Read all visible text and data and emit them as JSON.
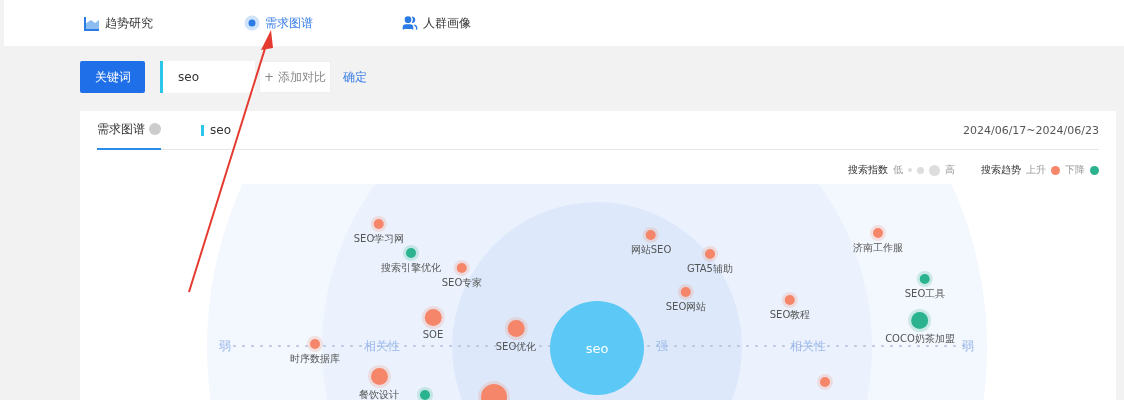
{
  "nav": {
    "items": [
      {
        "kind": "trend",
        "label": "趋势研究",
        "selected": false
      },
      {
        "kind": "graph",
        "label": "需求图谱",
        "selected": true
      },
      {
        "kind": "people",
        "label": "人群画像",
        "selected": false
      }
    ]
  },
  "toolbar": {
    "keyword_button": "关键词",
    "keyword_value": "seo",
    "add_compare": "+ 添加对比",
    "confirm": "确定"
  },
  "card": {
    "tabs": [
      {
        "label": "需求图谱",
        "selected": true
      }
    ],
    "series_label": "seo",
    "date_range": "2024/06/17~2024/06/23",
    "legend": {
      "index_title": "搜索指数",
      "low": "低",
      "high": "高",
      "trend_title": "搜索趋势",
      "up": "上升",
      "down": "下降"
    },
    "graph": {
      "center": "seo",
      "axis_labels": [
        "弱",
        "相关性",
        "强",
        "相关性",
        "弱"
      ],
      "nodes": [
        {
          "label": "SEO学习网",
          "rising": true,
          "kind": "small"
        },
        {
          "label": "搜索引擎优化",
          "rising": false,
          "kind": "small"
        },
        {
          "label": "SEO专家",
          "rising": true,
          "kind": "small"
        },
        {
          "label": "SOE",
          "rising": true,
          "kind": "medium"
        },
        {
          "label": "SEO优化",
          "rising": true,
          "kind": "medium"
        },
        {
          "label": "时序数据库",
          "rising": true,
          "kind": "small"
        },
        {
          "label": "餐饮设计",
          "rising": true,
          "kind": "medium"
        },
        {
          "rising": false,
          "kind": "small"
        },
        {
          "rising": true,
          "kind": "large"
        },
        {
          "label": "网站SEO",
          "rising": true,
          "kind": "small"
        },
        {
          "label": "GTA5辅助",
          "rising": true,
          "kind": "small"
        },
        {
          "label": "SEO网站",
          "rising": true,
          "kind": "small"
        },
        {
          "label": "SEO教程",
          "rising": true,
          "kind": "small"
        },
        {
          "label": "济南工作服",
          "rising": true,
          "kind": "small"
        },
        {
          "label": "SEO工具",
          "rising": false,
          "kind": "small"
        },
        {
          "label": "COCO奶茶加盟",
          "rising": false,
          "kind": "medium"
        },
        {
          "rising": true,
          "kind": "small"
        }
      ]
    }
  }
}
